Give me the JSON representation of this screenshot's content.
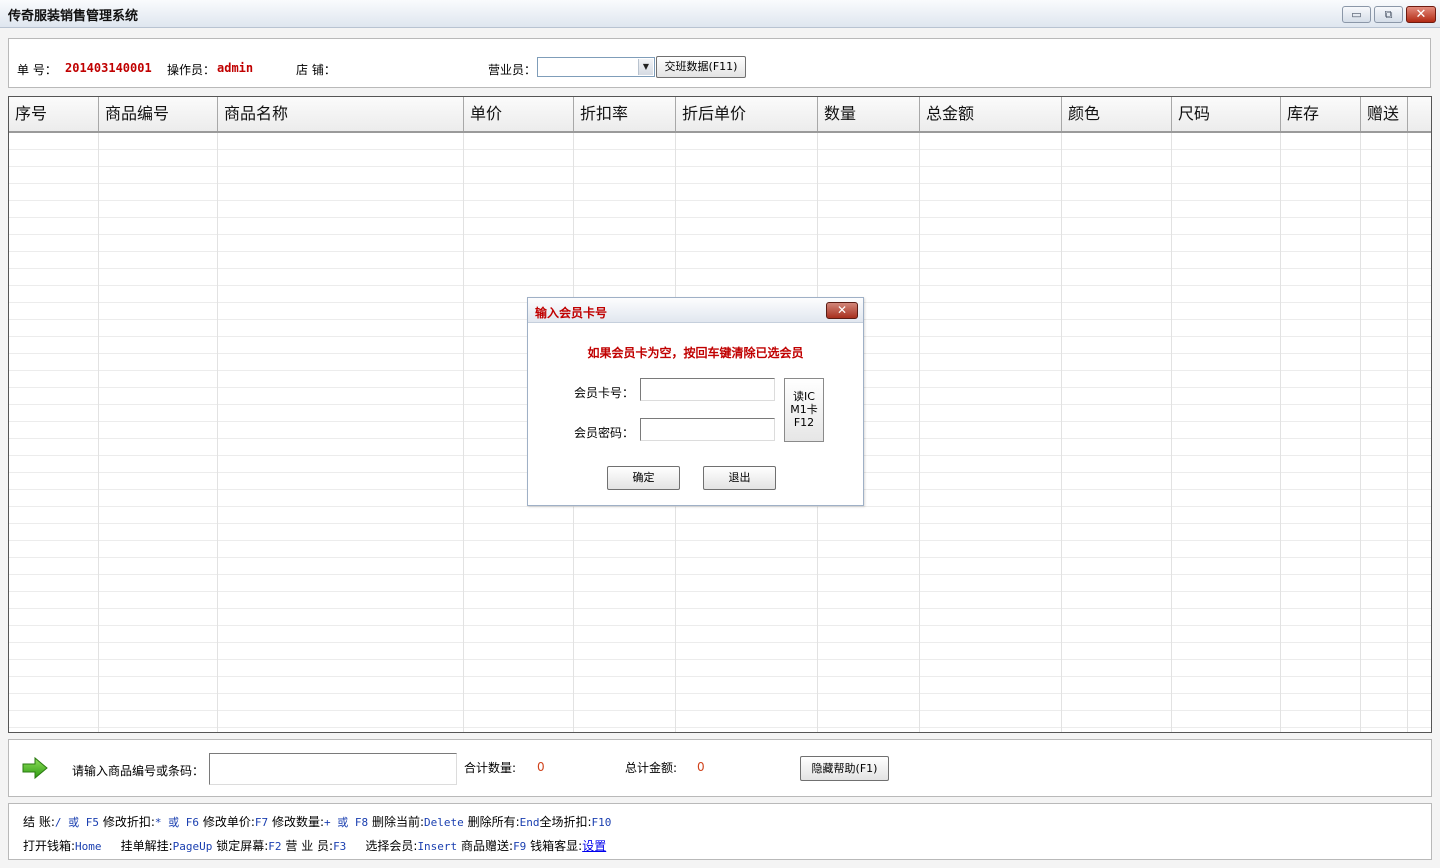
{
  "window": {
    "title": "传奇服装销售管理系统",
    "min_glyph": "▭",
    "max_glyph": "⧉",
    "close_glyph": "✕"
  },
  "header": {
    "order_no_label": "单 号：",
    "order_no_value": "201403140001",
    "operator_label": "操作员：",
    "operator_value": "admin",
    "store_label": "店 铺：",
    "salesperson_label": "营业员：",
    "salesperson_value": "",
    "handover_button": "交班数据(F11)"
  },
  "grid": {
    "columns": [
      "序号",
      "商品编号",
      "商品名称",
      "单价",
      "折扣率",
      "折后单价",
      "数量",
      "总金额",
      "颜色",
      "尺码",
      "库存",
      "赠送"
    ]
  },
  "dialog": {
    "title": "输入会员卡号",
    "message": "如果会员卡为空，按回车键清除已选会员",
    "card_label": "会员卡号：",
    "card_value": "",
    "password_label": "会员密码：",
    "password_value": "",
    "ic_button": [
      "读IC",
      "M1卡",
      "F12"
    ],
    "ok_button": "确定",
    "exit_button": "退出"
  },
  "entry": {
    "prompt": "请输入商品编号或条码：",
    "code_value": "",
    "qty_label": "合计数量:",
    "qty_value": "0",
    "amount_label": "总计金额:",
    "amount_value": "0",
    "hide_help_button": "隐藏帮助(F1)"
  },
  "help": {
    "row1": [
      {
        "label": "结    账:",
        "key": "/ 或 F5"
      },
      {
        "label": "修改折扣:",
        "key": "* 或 F6"
      },
      {
        "label": "修改单价:",
        "key": "F7"
      },
      {
        "label": "修改数量:",
        "key": "+ 或 F8"
      },
      {
        "label": "删除当前:",
        "key": "Delete"
      },
      {
        "label": "删除所有:",
        "key": "End"
      },
      {
        "label": "全场折扣:",
        "key": "F10"
      }
    ],
    "row2": [
      {
        "label": "打开钱箱:",
        "key": "Home"
      },
      {
        "label": "挂单解挂:",
        "key": "PageUp"
      },
      {
        "label": "锁定屏幕:",
        "key": "F2"
      },
      {
        "label": "营 业 员:",
        "key": "F3"
      },
      {
        "label": "选择会员:",
        "key": "Insert"
      },
      {
        "label": "商品赠送:",
        "key": "F9"
      },
      {
        "label": "钱箱客显:",
        "link": "设置"
      }
    ]
  }
}
